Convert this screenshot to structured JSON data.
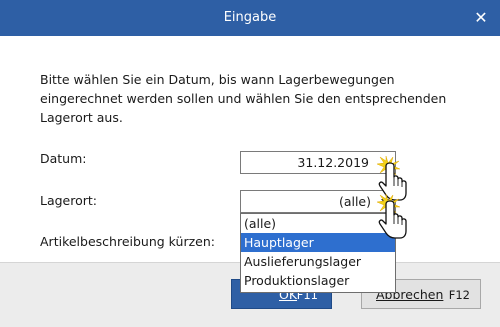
{
  "window": {
    "title": "Eingabe",
    "close_icon": "close-icon",
    "titlebar_color": "#2e5fa5"
  },
  "intro": {
    "text": "Bitte wählen Sie ein Datum, bis wann Lagerbewegungen eingerechnet werden sollen und wählen Sie den entsprechenden Lagerort aus."
  },
  "form": {
    "date_label": "Datum:",
    "date_value": "31.12.2019",
    "location_label": "Lagerort:",
    "location_value": "(alle)",
    "shorten_label": "Artikelbeschreibung kürzen:"
  },
  "dropdown": {
    "options": [
      "(alle)",
      "Hauptlager",
      "Auslieferungslager",
      "Produktionslager"
    ],
    "highlighted": "Hauptlager",
    "highlight_color": "#2e6fcf"
  },
  "buttons": {
    "ok_label": "OK",
    "ok_key": "F11",
    "cancel_label": "Abbrechen",
    "cancel_key": "F12"
  },
  "cursor_icons": [
    "hand-pointer-click-icon",
    "hand-pointer-click-icon"
  ]
}
